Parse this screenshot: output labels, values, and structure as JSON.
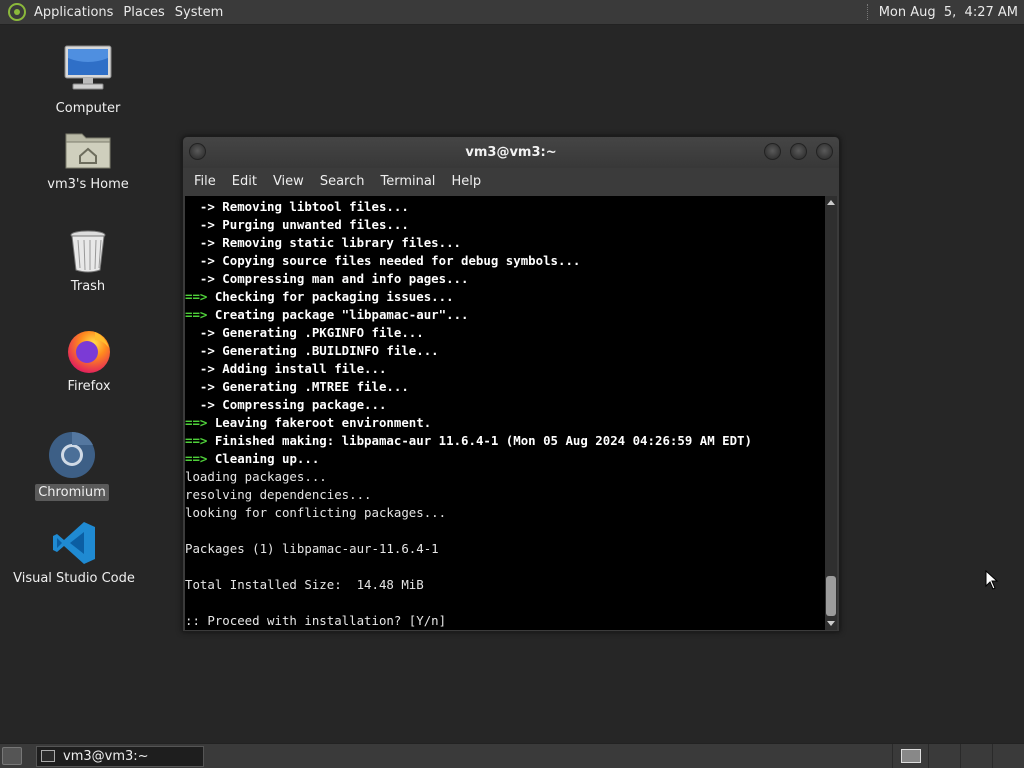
{
  "top_panel": {
    "menus": [
      "Applications",
      "Places",
      "System"
    ],
    "clock": "Mon Aug  5,  4:27 AM"
  },
  "desktop_icons": [
    {
      "label": "Computer",
      "icon": "computer-icon"
    },
    {
      "label": "vm3's Home",
      "icon": "home-folder-icon"
    },
    {
      "label": "Trash",
      "icon": "trash-icon"
    },
    {
      "label": "Firefox",
      "icon": "firefox-icon"
    },
    {
      "label": "Chromium",
      "icon": "chromium-icon"
    },
    {
      "label": "Visual Studio Code",
      "icon": "vscode-icon"
    }
  ],
  "window": {
    "title": "vm3@vm3:~",
    "menu": [
      "File",
      "Edit",
      "View",
      "Search",
      "Terminal",
      "Help"
    ]
  },
  "terminal": {
    "lines": [
      {
        "prefix": "",
        "text": "  -> Removing libtool files...",
        "bold": true
      },
      {
        "prefix": "",
        "text": "  -> Purging unwanted files...",
        "bold": true
      },
      {
        "prefix": "",
        "text": "  -> Removing static library files...",
        "bold": true
      },
      {
        "prefix": "",
        "text": "  -> Copying source files needed for debug symbols...",
        "bold": true
      },
      {
        "prefix": "",
        "text": "  -> Compressing man and info pages...",
        "bold": true
      },
      {
        "prefix": "==>",
        "text": " Checking for packaging issues...",
        "bold": true
      },
      {
        "prefix": "==>",
        "text": " Creating package \"libpamac-aur\"...",
        "bold": true
      },
      {
        "prefix": "",
        "text": "  -> Generating .PKGINFO file...",
        "bold": true
      },
      {
        "prefix": "",
        "text": "  -> Generating .BUILDINFO file...",
        "bold": true
      },
      {
        "prefix": "",
        "text": "  -> Adding install file...",
        "bold": true
      },
      {
        "prefix": "",
        "text": "  -> Generating .MTREE file...",
        "bold": true
      },
      {
        "prefix": "",
        "text": "  -> Compressing package...",
        "bold": true
      },
      {
        "prefix": "==>",
        "text": " Leaving fakeroot environment.",
        "bold": true
      },
      {
        "prefix": "==>",
        "text": " Finished making: libpamac-aur 11.6.4-1 (Mon 05 Aug 2024 04:26:59 AM EDT)",
        "bold": true
      },
      {
        "prefix": "==>",
        "text": " Cleaning up...",
        "bold": true
      },
      {
        "prefix": "",
        "text": "loading packages...",
        "bold": false
      },
      {
        "prefix": "",
        "text": "resolving dependencies...",
        "bold": false
      },
      {
        "prefix": "",
        "text": "looking for conflicting packages...",
        "bold": false
      },
      {
        "prefix": "",
        "text": "",
        "bold": false
      },
      {
        "prefix": "",
        "text": "Packages (1) libpamac-aur-11.6.4-1",
        "bold": false
      },
      {
        "prefix": "",
        "text": "",
        "bold": false
      },
      {
        "prefix": "",
        "text": "Total Installed Size:  14.48 MiB",
        "bold": false
      },
      {
        "prefix": "",
        "text": "",
        "bold": false
      },
      {
        "prefix": "",
        "text": ":: Proceed with installation? [Y/n]",
        "bold": false
      }
    ]
  },
  "bottom_panel": {
    "task_title": "vm3@vm3:~"
  }
}
